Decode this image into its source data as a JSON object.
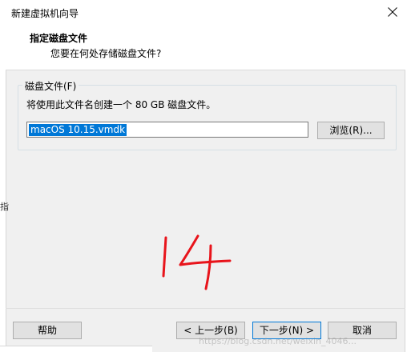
{
  "window": {
    "title": "新建虚拟机向导"
  },
  "header": {
    "title": "指定磁盘文件",
    "subtitle": "您要在何处存储磁盘文件?"
  },
  "group": {
    "label": "磁盘文件(F)",
    "description": "将使用此文件名创建一个 80 GB 磁盘文件。"
  },
  "file_input": {
    "value": "macOS 10.15.vmdk"
  },
  "buttons": {
    "browse": "浏览(R)...",
    "help": "帮助",
    "back": "< 上一步(B)",
    "next": "下一步(N) >",
    "cancel": "取消"
  },
  "annotation": {
    "handwritten_number": "14"
  },
  "left_fragment": "指",
  "watermark": "https://blog.csdn.net/weixin_4046...",
  "colors": {
    "selection": "#0078d7",
    "handwriting": "#e8141b",
    "dialog_bg": "#f0f0f0"
  }
}
